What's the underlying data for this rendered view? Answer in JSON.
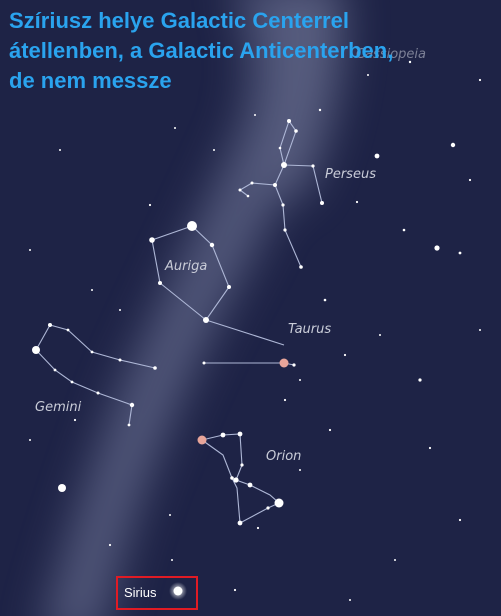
{
  "title": {
    "line1": "Szíriusz helye Galactic Centerrel",
    "line2": "átellenben, a Galactic Anticenterben,",
    "line3": "de nem messze"
  },
  "constellations": {
    "perseus": "Perseus",
    "auriga": "Auriga",
    "taurus": "Taurus",
    "gemini": "Gemini",
    "orion": "Orion",
    "cassiopeia_partial": "Cassiopeia"
  },
  "highlight": {
    "label": "Sirius",
    "box_color": "#e01b24"
  },
  "colors": {
    "sky": "#1e2346",
    "milky_way": "#6e7494",
    "title": "#2aa3ee",
    "lines": "#aeb7d6",
    "star": "#ffffff",
    "red_giant": "#e8a59a"
  }
}
